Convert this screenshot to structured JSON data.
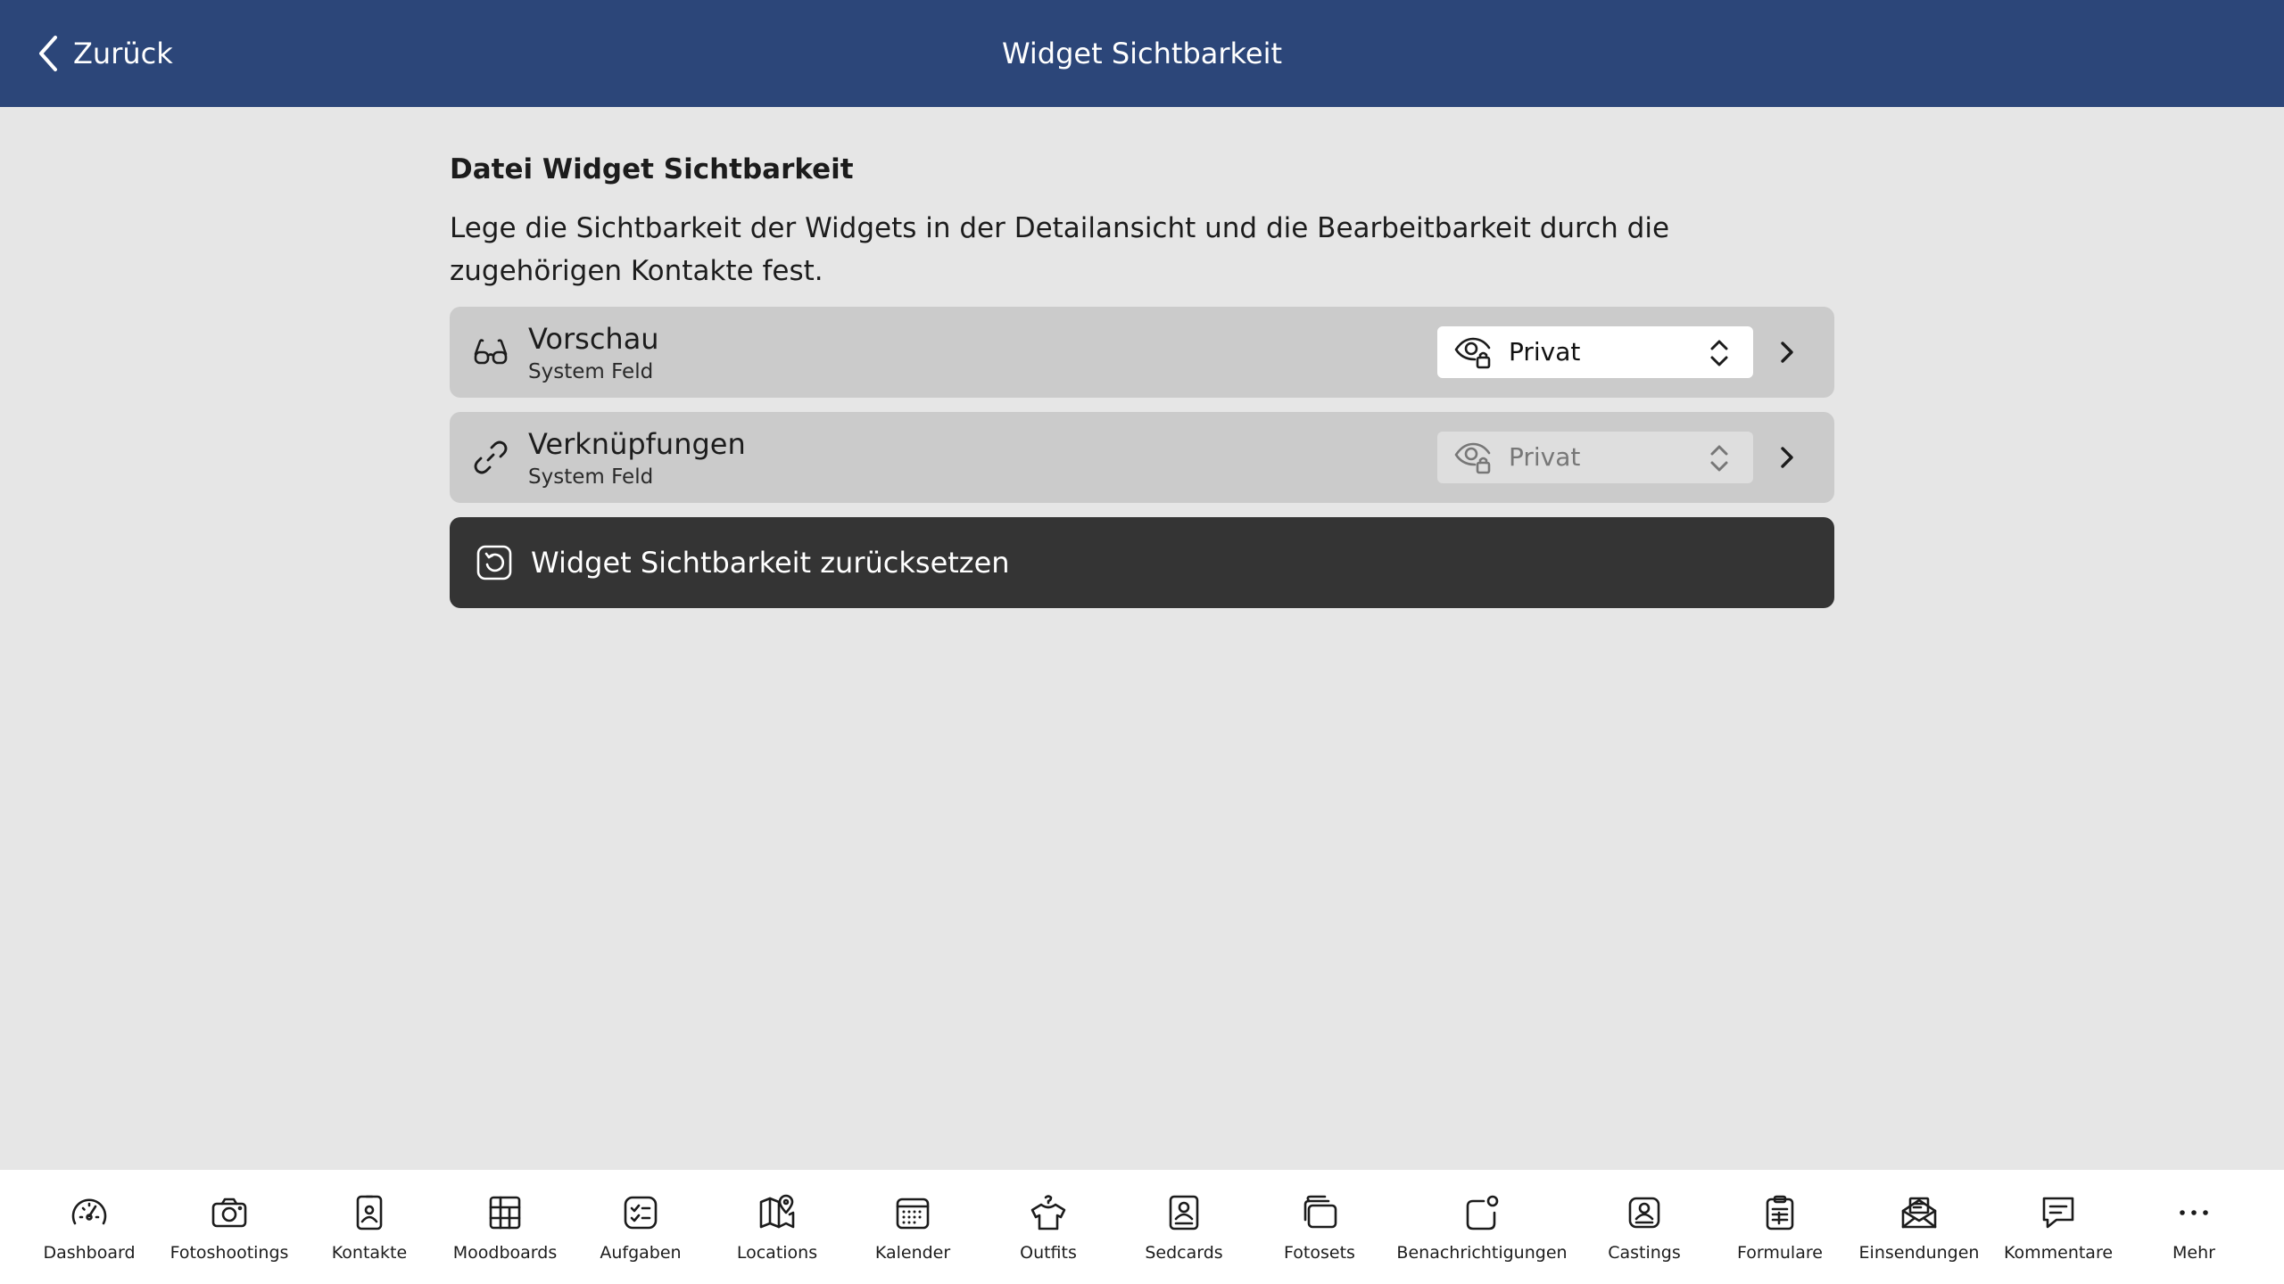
{
  "header": {
    "back_label": "Zurück",
    "title": "Widget Sichtbarkeit"
  },
  "main": {
    "section_title": "Datei Widget Sichtbarkeit",
    "description": "Lege die Sichtbarkeit der Widgets in der Detailansicht und die Bearbeitbarkeit durch die zugehörigen Kontakte fest.",
    "rows": [
      {
        "title": "Vorschau",
        "subtitle": "System Feld",
        "visibility": "Privat",
        "icon": "glasses-icon",
        "enabled": true
      },
      {
        "title": "Verknüpfungen",
        "subtitle": "System Feld",
        "visibility": "Privat",
        "icon": "link-icon",
        "enabled": false
      }
    ],
    "reset_label": "Widget Sichtbarkeit zurücksetzen"
  },
  "tabbar": {
    "items": [
      {
        "label": "Dashboard",
        "icon": "speedometer-icon"
      },
      {
        "label": "Fotoshootings",
        "icon": "camera-icon"
      },
      {
        "label": "Kontakte",
        "icon": "contact-card-icon"
      },
      {
        "label": "Moodboards",
        "icon": "moodboard-grid-icon"
      },
      {
        "label": "Aufgaben",
        "icon": "checklist-icon"
      },
      {
        "label": "Locations",
        "icon": "map-pin-icon"
      },
      {
        "label": "Kalender",
        "icon": "calendar-icon"
      },
      {
        "label": "Outfits",
        "icon": "hanger-shirt-icon"
      },
      {
        "label": "Sedcards",
        "icon": "sedcard-icon"
      },
      {
        "label": "Fotosets",
        "icon": "photo-stack-icon"
      },
      {
        "label": "Benachrichtigungen",
        "icon": "notification-icon"
      },
      {
        "label": "Castings",
        "icon": "casting-icon"
      },
      {
        "label": "Formulare",
        "icon": "clipboard-form-icon"
      },
      {
        "label": "Einsendungen",
        "icon": "envelope-icon"
      },
      {
        "label": "Kommentare",
        "icon": "comment-icon"
      },
      {
        "label": "Mehr",
        "icon": "more-dots-icon"
      }
    ]
  },
  "colors": {
    "header_bg": "#2c4679",
    "page_bg": "#e6e6e6",
    "row_bg": "#cbcbcb",
    "reset_bg": "#343434",
    "tabbar_bg": "#ffffff"
  }
}
